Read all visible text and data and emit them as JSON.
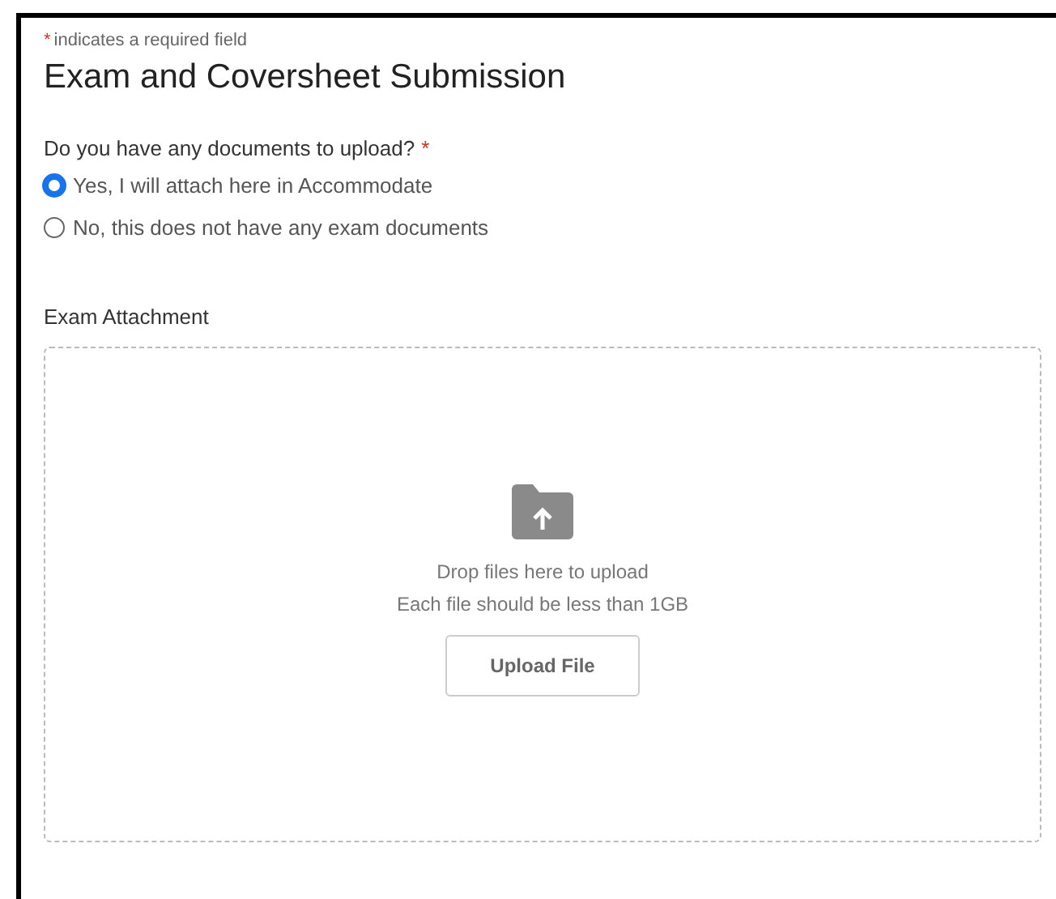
{
  "required_note": {
    "marker": "*",
    "text": "indicates a required field"
  },
  "title": "Exam and Coversheet Submission",
  "question": {
    "label": "Do you have any documents to upload?",
    "marker": "*",
    "options": [
      {
        "label": "Yes, I will attach here in Accommodate",
        "selected": true
      },
      {
        "label": "No, this does not have any exam documents",
        "selected": false
      }
    ]
  },
  "attachment": {
    "label": "Exam Attachment",
    "drop_text": "Drop files here to upload",
    "size_text": "Each file should be less than 1GB",
    "button": "Upload File"
  }
}
